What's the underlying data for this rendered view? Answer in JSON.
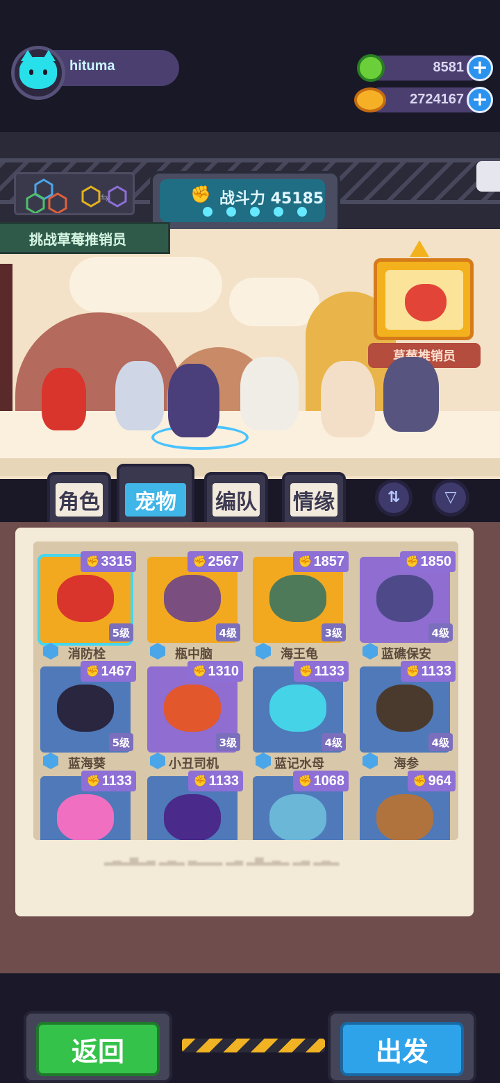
{
  "user": {
    "name": "hituma"
  },
  "currency": {
    "gems": "8581",
    "coins": "2724167"
  },
  "battle": {
    "label": "战斗力 45185"
  },
  "challenge": {
    "label": "挑战草莓推销员"
  },
  "boss": {
    "tag": "草莓推销员"
  },
  "tabs": [
    {
      "label": "角色",
      "active": false
    },
    {
      "label": "宠物",
      "active": true
    },
    {
      "label": "编队",
      "active": false
    },
    {
      "label": "情缘",
      "active": false
    }
  ],
  "pets": [
    {
      "name": "消防栓",
      "power": "3315",
      "level": "5级",
      "bg": "#f2a91f",
      "color": "#d9352c",
      "selected": true
    },
    {
      "name": "瓶中脑",
      "power": "2567",
      "level": "4级",
      "bg": "#f2a91f",
      "color": "#7a4f7f",
      "selected": false
    },
    {
      "name": "海王龟",
      "power": "1857",
      "level": "3级",
      "bg": "#f2a91f",
      "color": "#4f7a5a",
      "selected": false
    },
    {
      "name": "蓝礁保安",
      "power": "1850",
      "level": "4级",
      "bg": "#8f6dd1",
      "color": "#4e4a8a",
      "selected": false
    },
    {
      "name": "蓝海葵",
      "power": "1467",
      "level": "5级",
      "bg": "#4f79b9",
      "color": "#2a2640",
      "selected": false
    },
    {
      "name": "小丑司机",
      "power": "1310",
      "level": "3级",
      "bg": "#8f6dd1",
      "color": "#e2572b",
      "selected": false
    },
    {
      "name": "蓝记水母",
      "power": "1133",
      "level": "4级",
      "bg": "#4f79b9",
      "color": "#45d3e8",
      "selected": false
    },
    {
      "name": "海参",
      "power": "1133",
      "level": "4级",
      "bg": "#4f79b9",
      "color": "#4a3a2e",
      "selected": false
    },
    {
      "name": "",
      "power": "1133",
      "level": "",
      "bg": "#4f79b9",
      "color": "#f06fc0",
      "selected": false
    },
    {
      "name": "",
      "power": "1133",
      "level": "",
      "bg": "#4f79b9",
      "color": "#4a2a8a",
      "selected": false
    },
    {
      "name": "",
      "power": "1068",
      "level": "",
      "bg": "#4f79b9",
      "color": "#6ab7d8",
      "selected": false
    },
    {
      "name": "",
      "power": "964",
      "level": "",
      "bg": "#4f79b9",
      "color": "#b0733e",
      "selected": false
    }
  ],
  "buttons": {
    "back": "返回",
    "go": "出发"
  },
  "icons": {
    "sort": "sort-icon",
    "filter": "filter-icon",
    "add": "+"
  }
}
